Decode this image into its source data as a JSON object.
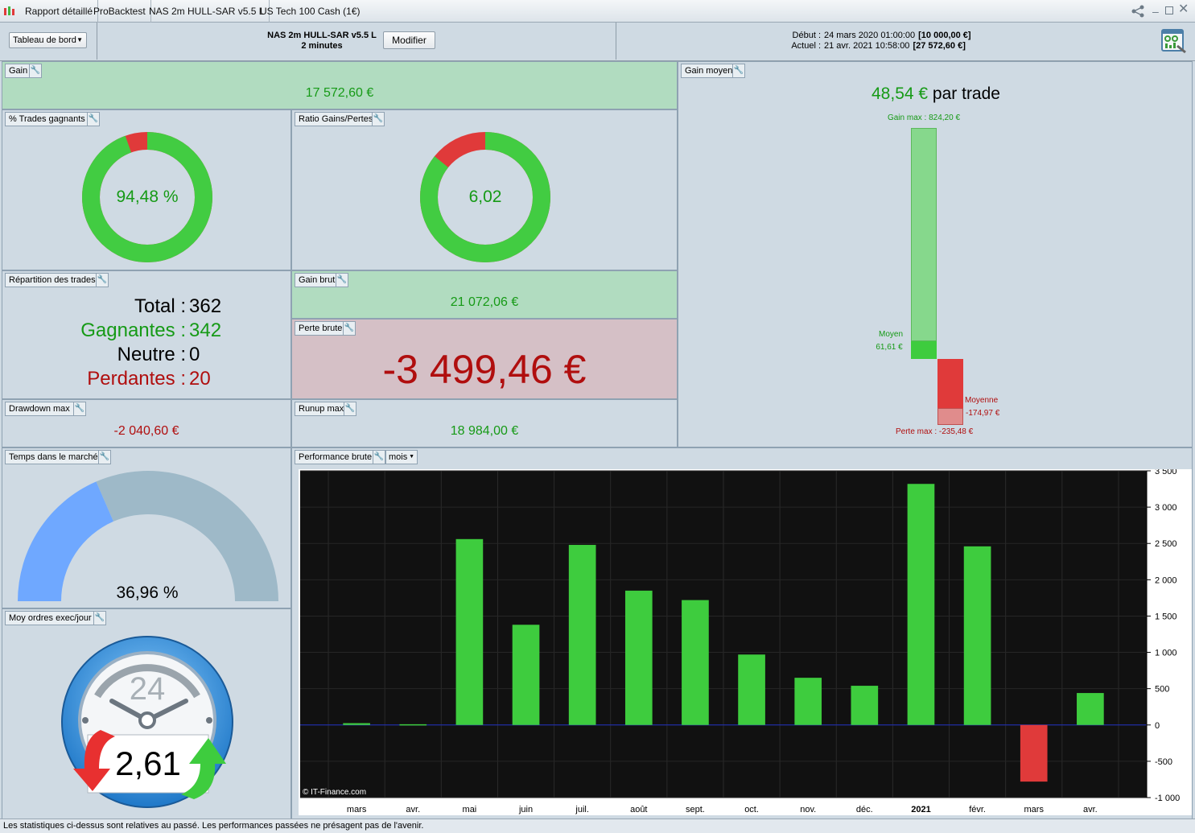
{
  "titlebar": {
    "tabs": [
      "Rapport détaillé",
      "ProBacktest",
      "NAS 2m HULL-SAR v5.5 L",
      "US Tech 100 Cash (1€)"
    ]
  },
  "header": {
    "dashboard_select": "Tableau de bord",
    "strategy_name": "NAS 2m HULL-SAR v5.5 L",
    "timeframe": "2 minutes",
    "modify_button": "Modifier",
    "start_label": "Début :",
    "start_date": "24 mars 2020 01:00:00",
    "start_value": "[10 000,00 €]",
    "current_label": "Actuel :",
    "current_date": "21 avr. 2021 10:58:00",
    "current_value": "[27 572,60 €]"
  },
  "gain": {
    "title": "Gain",
    "value": "17 572,60 €"
  },
  "winning_trades": {
    "title": "% Trades gagnants",
    "value": "94,48 %",
    "fraction": 0.9448
  },
  "ratio": {
    "title": "Ratio Gains/Pertes",
    "value": "6,02",
    "fraction": 0.8576
  },
  "repartition": {
    "title": "Répartition des trades",
    "total_label": "Total :",
    "total": "362",
    "win_label": "Gagnantes :",
    "win": "342",
    "neutral_label": "Neutre :",
    "neutral": "0",
    "loss_label": "Perdantes :",
    "loss": "20"
  },
  "gross_gain": {
    "title": "Gain brut",
    "value": "21 072,06 €"
  },
  "gross_loss": {
    "title": "Perte brute",
    "value": "-3 499,46 €"
  },
  "drawdown": {
    "title": "Drawdown max",
    "value": "-2 040,60 €"
  },
  "runup": {
    "title": "Runup max",
    "value": "18 984,00 €"
  },
  "avg_gain": {
    "title": "Gain moyen",
    "value": "48,54 €",
    "suffix": "par trade",
    "max_gain_label": "Gain max : 824,20 €",
    "avg_win_label": "Moyen",
    "avg_win_value": "61,61 €",
    "avg_loss_label": "Moyenne",
    "avg_loss_value": "-174,97 €",
    "max_loss_label": "Perte max : -235,48 €"
  },
  "time_in_market": {
    "title": "Temps dans le marché",
    "value": "36,96 %",
    "fraction": 0.3696
  },
  "orders_per_day": {
    "title": "Moy ordres exec/jour",
    "clock_label": "24",
    "value": "2,61"
  },
  "performance": {
    "title": "Performance brute",
    "period_select": "mois",
    "copyright": "© IT-Finance.com"
  },
  "chart_data": {
    "type": "bar",
    "categories": [
      "mars",
      "avr.",
      "mai",
      "juin",
      "juil.",
      "août",
      "sept.",
      "oct.",
      "nov.",
      "déc.",
      "2021",
      "févr.",
      "mars",
      "avr."
    ],
    "values": [
      25,
      10,
      2560,
      1380,
      2480,
      1850,
      1720,
      970,
      650,
      540,
      3320,
      2460,
      -780,
      440
    ],
    "ylim": [
      -1000,
      3500
    ],
    "yticks": [
      3500,
      3000,
      2500,
      2000,
      1500,
      1000,
      500,
      0,
      -500,
      -1000
    ],
    "ytick_labels": [
      "3 500",
      "3 000",
      "2 500",
      "2 000",
      "1 500",
      "1 000",
      "500",
      "0",
      "-500",
      "-1 000"
    ],
    "positive_color": "#3ecc3e",
    "negative_color": "#e03a3a",
    "background": "#111111",
    "grid": true
  },
  "footer": {
    "text": "Les statistiques ci-dessus sont relatives au passé. Les performances passées ne présagent pas de l'avenir."
  },
  "colors": {
    "panel_bg": "#cfdae3",
    "gain_bg": "#b1dcc0",
    "loss_bg": "#d5c0c6",
    "donut_green": "#42cc42",
    "donut_red": "#e03a3a",
    "gauge_blue": "#6fa8ff",
    "gauge_grey": "#9eb9c8"
  }
}
